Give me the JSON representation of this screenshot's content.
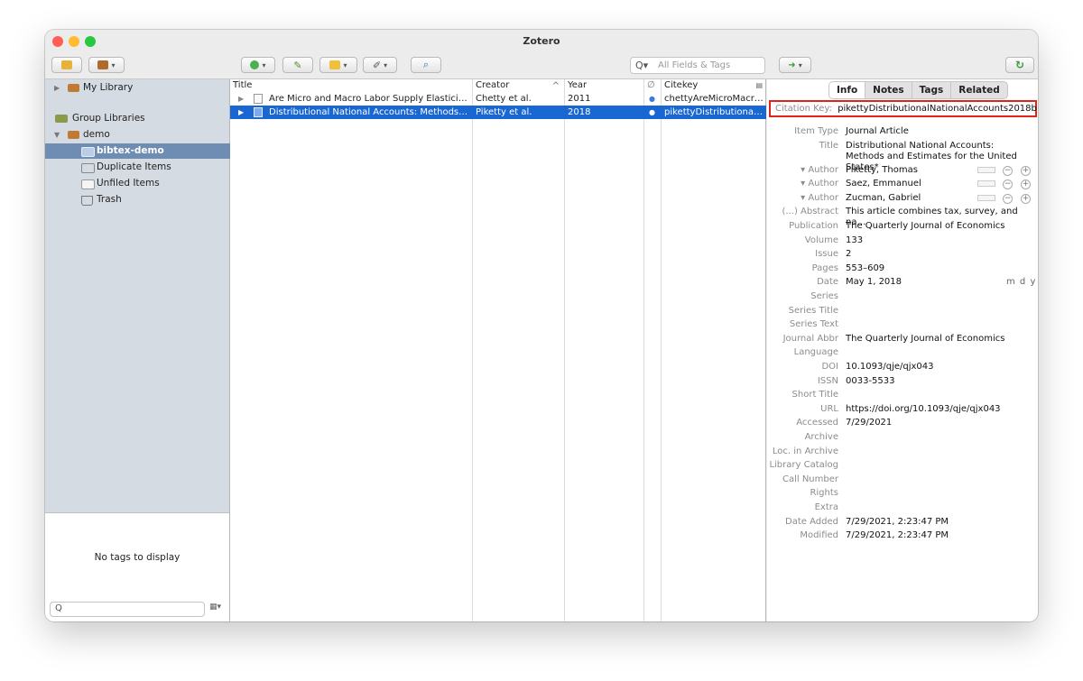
{
  "window": {
    "title": "Zotero"
  },
  "toolbar": {
    "search_placeholder": "All Fields & Tags"
  },
  "sidebar": {
    "my_library": "My Library",
    "group_libraries": "Group Libraries",
    "group": "demo",
    "items": [
      {
        "label": "bibtex-demo",
        "selected": true
      },
      {
        "label": "Duplicate Items"
      },
      {
        "label": "Unfiled Items"
      },
      {
        "label": "Trash"
      }
    ]
  },
  "tag_selector": {
    "empty_message": "No tags to display"
  },
  "items": {
    "columns": {
      "title": "Title",
      "creator": "Creator",
      "sort_indicator": "^",
      "year": "Year",
      "citekey": "Citekey"
    },
    "rows": [
      {
        "title": "Are Micro and Macro Labor Supply Elasticitie…",
        "creator": "Chetty et al.",
        "year": "2011",
        "citekey": "chettyAreMicroMacro…",
        "selected": false
      },
      {
        "title": "Distributional National Accounts: Methods a…",
        "creator": "Piketty et al.",
        "year": "2018",
        "citekey": "pikettyDistributional…",
        "selected": true
      }
    ]
  },
  "item_pane": {
    "tabs": [
      "Info",
      "Notes",
      "Tags",
      "Related"
    ],
    "active_tab": "Info",
    "citation_key_label": "Citation Key:",
    "citation_key_value": "pikettyDistributionalNationalAccounts2018b",
    "fields": [
      {
        "label": "Item Type",
        "value": "Journal Article"
      },
      {
        "label": "Title",
        "value": "Distributional National Accounts: Methods and Estimates for the United States*"
      },
      {
        "label": "▾ Author",
        "value": "Piketty, Thomas"
      },
      {
        "label": "▾ Author",
        "value": "Saez, Emmanuel"
      },
      {
        "label": "▾ Author",
        "value": "Zucman, Gabriel"
      },
      {
        "label": "(...) Abstract",
        "value": "This article combines tax, survey, and na…"
      },
      {
        "label": "Publication",
        "value": "The Quarterly Journal of Economics"
      },
      {
        "label": "Volume",
        "value": "133"
      },
      {
        "label": "Issue",
        "value": "2"
      },
      {
        "label": "Pages",
        "value": "553–609"
      },
      {
        "label": "Date",
        "value": "May 1, 2018"
      },
      {
        "label": "Series",
        "value": ""
      },
      {
        "label": "Series Title",
        "value": ""
      },
      {
        "label": "Series Text",
        "value": ""
      },
      {
        "label": "Journal Abbr",
        "value": "The Quarterly Journal of Economics"
      },
      {
        "label": "Language",
        "value": ""
      },
      {
        "label": "DOI",
        "value": "10.1093/qje/qjx043"
      },
      {
        "label": "ISSN",
        "value": "0033-5533"
      },
      {
        "label": "Short Title",
        "value": ""
      },
      {
        "label": "URL",
        "value": "https://doi.org/10.1093/qje/qjx043"
      },
      {
        "label": "Accessed",
        "value": "7/29/2021"
      },
      {
        "label": "Archive",
        "value": ""
      },
      {
        "label": "Loc. in Archive",
        "value": ""
      },
      {
        "label": "Library Catalog",
        "value": ""
      },
      {
        "label": "Call Number",
        "value": ""
      },
      {
        "label": "Rights",
        "value": ""
      },
      {
        "label": "Extra",
        "value": ""
      },
      {
        "label": "Date Added",
        "value": "7/29/2021, 2:23:47 PM"
      },
      {
        "label": "Modified",
        "value": "7/29/2021, 2:23:47 PM"
      }
    ],
    "date_format": "m d y"
  }
}
